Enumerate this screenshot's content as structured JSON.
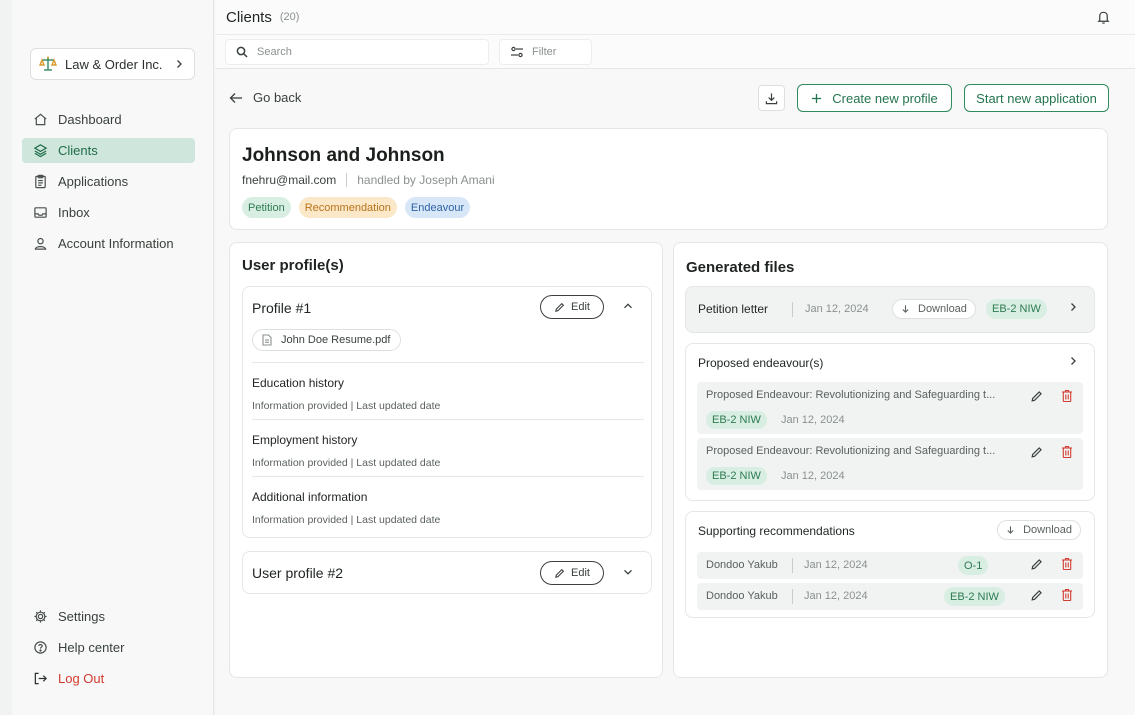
{
  "sidebar": {
    "org_name": "Law & Order Inc.",
    "nav": [
      {
        "label": "Dashboard",
        "icon": "home-icon"
      },
      {
        "label": "Clients",
        "icon": "layers-icon"
      },
      {
        "label": "Applications",
        "icon": "clipboard-icon"
      },
      {
        "label": "Inbox",
        "icon": "inbox-icon"
      },
      {
        "label": "Account Information",
        "icon": "user-icon"
      }
    ],
    "bottom": [
      {
        "label": "Settings",
        "icon": "gear-icon"
      },
      {
        "label": "Help center",
        "icon": "help-icon"
      },
      {
        "label": "Log Out",
        "icon": "logout-icon"
      }
    ]
  },
  "topbar": {
    "title": "Clients",
    "count": "(20)"
  },
  "search": {
    "placeholder": "Search",
    "filter_label": "Filter"
  },
  "actions": {
    "go_back": "Go back",
    "create_profile": "Create new profile",
    "start_application": "Start new application"
  },
  "client": {
    "name": "Johnson and Johnson",
    "email": "fnehru@mail.com",
    "handled_by": "handled by Joseph Amani",
    "tags": [
      "Petition",
      "Recommendation",
      "Endeavour"
    ]
  },
  "profiles": {
    "title": "User profile(s)",
    "edit_label": "Edit",
    "profile1": {
      "title": "Profile #1",
      "file": "John Doe Resume.pdf",
      "sections": [
        {
          "title": "Education history",
          "sub": "Information provided | Last updated date"
        },
        {
          "title": "Employment history",
          "sub": "Information provided | Last updated date"
        },
        {
          "title": "Additional information",
          "sub": "Information provided | Last updated date"
        }
      ]
    },
    "profile2": {
      "title": "User profile #2"
    }
  },
  "generated": {
    "title": "Generated files",
    "download_label": "Download",
    "petition": {
      "label": "Petition letter",
      "date": "Jan 12, 2024",
      "tag": "EB-2 NIW"
    },
    "endeavours": {
      "title": "Proposed endeavour(s)",
      "items": [
        {
          "text": "Proposed Endeavour: Revolutionizing and Safeguarding t...",
          "tag": "EB-2 NIW",
          "date": "Jan 12, 2024"
        },
        {
          "text": "Proposed Endeavour: Revolutionizing and Safeguarding t...",
          "tag": "EB-2 NIW",
          "date": "Jan 12, 2024"
        }
      ]
    },
    "recommendations": {
      "title": "Supporting recommendations",
      "items": [
        {
          "name": "Dondoo Yakub",
          "date": "Jan 12, 2024",
          "tag": "O-1"
        },
        {
          "name": "Dondoo Yakub",
          "date": "Jan 12, 2024",
          "tag": "EB-2 NIW"
        }
      ]
    }
  },
  "colors": {
    "accent": "#2f8a5e",
    "active_bg": "#cfe6dc",
    "danger": "#d23b2f"
  }
}
